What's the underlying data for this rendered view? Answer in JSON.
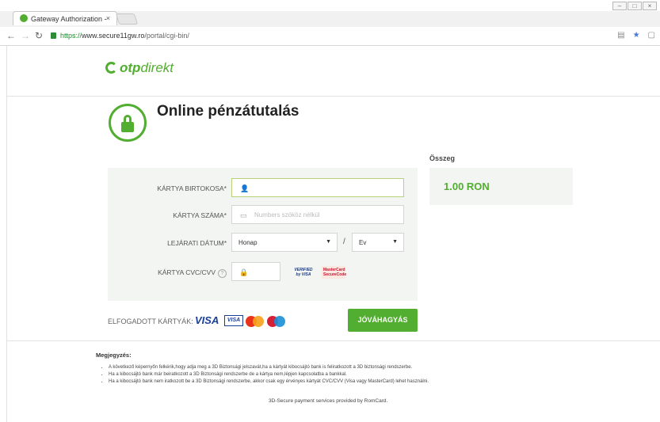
{
  "browser": {
    "tab_title": "Gateway Authorization -",
    "tab_close": "×",
    "url_scheme": "https://",
    "url_host": "www.secure11gw.ro",
    "url_path": "/portal/cgi-bin/"
  },
  "page": {
    "brand_bold": "otp",
    "brand_rest": "direkt",
    "title": "Online pénzátutalás",
    "form": {
      "holder_label": "KÁRTYA BIRTOKOSA*",
      "number_label": "KÁRTYA SZÁMA*",
      "number_placeholder": "Numbers szóköz nélkül",
      "expiry_label": "LEJÁRATI DÁTUM*",
      "month_value": "Honap",
      "separator": "/",
      "year_value": "Ev",
      "cvc_label": "KÁRTYA CVC/CVV",
      "cvc_help": "?",
      "vbv_label": "VERIFIED by VISA",
      "msc_label": "MasterCard SecureCode"
    },
    "amount": {
      "label": "Összeg",
      "value": "1.00 RON"
    },
    "accepted_label": "ELFOGADOTT KÁRTYÁK:",
    "accepted_cards": [
      "VISA",
      "VISA"
    ],
    "approve_button": "JÓVÁHAGYÁS",
    "note_title": "Megjegyzés:",
    "notes": [
      "A következő képernyőn felkérik,hogy adja meg a 3D Biztonsági jelszavát,ha a kártyát kibocsájtó bank is feliratkozott a 3D biztonsági rendszerbe.",
      "Ha a kibocsájtó bank már beiratkozott a 3D Biztonsági rendszerbe de a kártya nem,lépjen kapcsolatba a bankkal.",
      "Ha a kibocsájtó bank nem iratkozott be a 3D Biztonsági rendszerbe, akkor csak egy érvényes kártyát CVC/CVV (Visa vagy MasterCard) lehet használni."
    ],
    "footer": "3D-Secure payment services provided by RomCard."
  },
  "colors": {
    "brand_green": "#52ae30",
    "panel_bg": "#f2f5f1",
    "visa_blue": "#1a3f96"
  }
}
